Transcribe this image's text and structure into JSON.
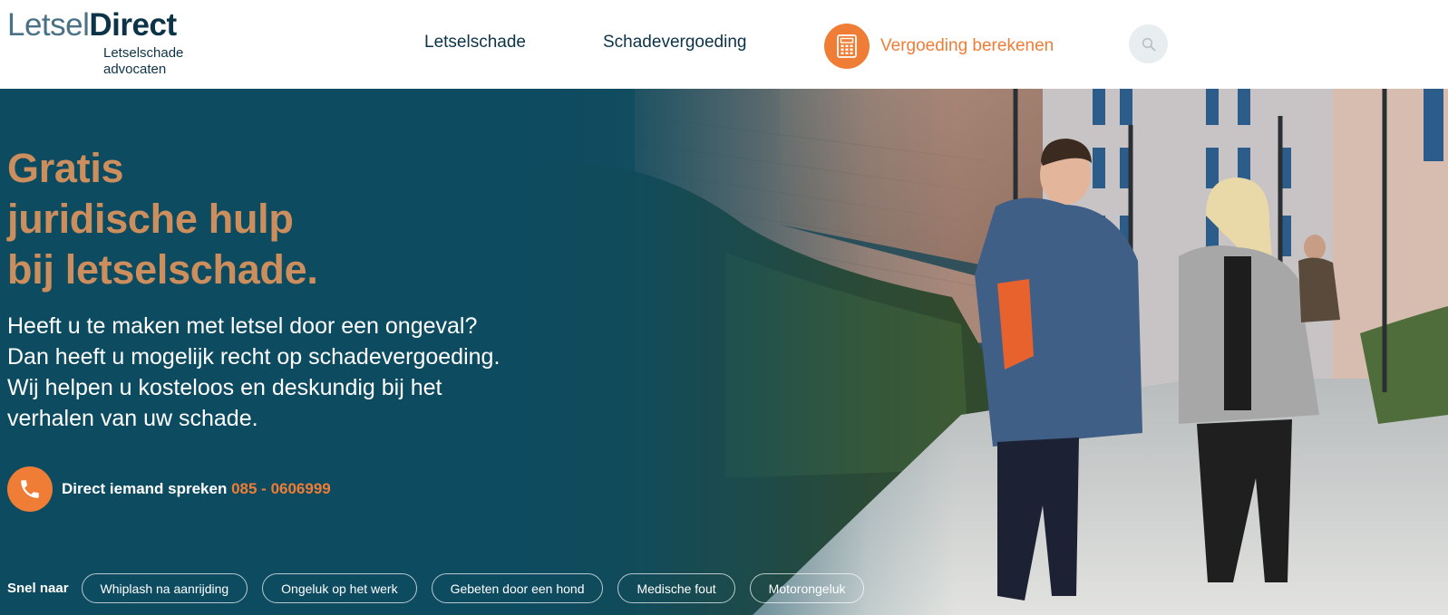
{
  "logo": {
    "word_part1": "Letsel",
    "word_part2": "Direct",
    "subtitle_line1": "Letselschade",
    "subtitle_line2": "advocaten"
  },
  "nav": {
    "items": [
      {
        "label": "Letselschade"
      },
      {
        "label": "Schadevergoeding"
      }
    ],
    "calculator": {
      "label": "Vergoeding berekenen",
      "icon": "calculator-icon"
    },
    "search": {
      "icon": "search-icon"
    }
  },
  "hero": {
    "headline": [
      "Gratis",
      "juridische hulp",
      "bij letselschade."
    ],
    "intro": [
      "Heeft u te maken met letsel door een ongeval?",
      "Dan heeft u mogelijk recht op schadevergoeding.",
      "Wij helpen u kosteloos en deskundig bij het",
      "verhalen van uw schade."
    ],
    "contact": {
      "text": "Direct iemand spreken",
      "phone": "085 - 0606999",
      "icon": "phone-icon"
    },
    "quick_links": {
      "label": "Snel naar",
      "items": [
        "Whiplash na aanrijding",
        "Ongeluk op het werk",
        "Gebeten door een hond",
        "Medische fout",
        "Motorongeluk"
      ]
    }
  },
  "colors": {
    "navy": "#0c3347",
    "teal": "#0d4b60",
    "orange": "#ef7d36",
    "copper": "#cd8e5d"
  }
}
